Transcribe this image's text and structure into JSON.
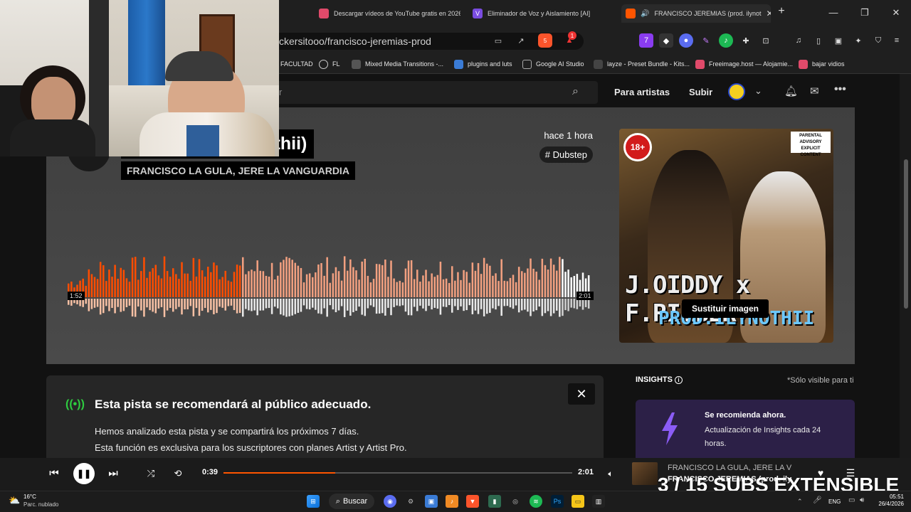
{
  "browser": {
    "tabs": [
      {
        "label": "Descargar vídeos de YouTube gratis en 2026",
        "color": "#e04a6a"
      },
      {
        "label": "Eliminador de Voz y Aislamiento [AI]",
        "color": "#7a4ce0"
      },
      {
        "label": "FRANCISCO JEREMIAS (prod. ilynot",
        "color": "#ff5500"
      }
    ],
    "url": "ckersitooo/francisco-jeremias-prod",
    "bookmarks": [
      {
        "label": "FACULTAD"
      },
      {
        "label": "FL"
      },
      {
        "label": "Mixed Media Transitions -..."
      },
      {
        "label": "plugins and luts"
      },
      {
        "label": "Google AI Studio"
      },
      {
        "label": "layze - Preset Bundle - Kits..."
      },
      {
        "label": "Freeimage.host — Alojamie..."
      },
      {
        "label": "bajar vidios"
      }
    ],
    "brave_badge": "5",
    "alert_badge": "1"
  },
  "nav": {
    "search_placeholder": "r",
    "for_artists": "Para artistas",
    "upload": "Subir"
  },
  "track": {
    "title": "MIAS (prod. ilynothii)",
    "artists": "FRANCISCO LA GULA, JERE LA VANGUARDIA",
    "posted": "hace 1 hora",
    "genre": "# Dubstep",
    "elapsed_badge": "1:52",
    "duration_badge": "2:01",
    "played_fraction": 0.33,
    "buffered_fraction": 0.94,
    "artwork": {
      "age_badge": "18+",
      "advisory": "PARENTAL ADVISORY EXPLICIT CONTENT",
      "title": "J.OIDDY x F.RIEBER",
      "prod": "PROD.ILYNOTHII",
      "replace_button": "Sustituir imagen"
    }
  },
  "recommendation": {
    "title": "Esta pista se recomendará al público adecuado.",
    "line1": "Hemos analizado esta pista y se compartirá los próximos 7 días.",
    "line2": "Esta función es exclusiva para los suscriptores con planes Artist y Artist Pro."
  },
  "insights": {
    "heading": "INSIGHTS",
    "note": "*Sólo visible para ti",
    "card_title": "Se recomienda ahora.",
    "card_text": "Actualización de Insights cada 24 horas."
  },
  "player": {
    "current": "0:39",
    "duration": "2:01",
    "progress_fraction": 0.32,
    "now_playing_artist": "FRANCISCO LA GULA, JERE LA V",
    "now_playing_title": "FRANCISCO JEREMIAS (prod. ilyn"
  },
  "overlay_text": "3 / 15 SUBS EXTENSIBLE",
  "taskbar": {
    "weather_temp": "16°C",
    "weather_desc": "Parc. nublado",
    "search": "Buscar",
    "lang": "ENG",
    "time": "05:51",
    "date": "26/4/2026"
  },
  "colors": {
    "accent": "#ff5500",
    "played": "#ff4d00",
    "unplayed": "#f2a080",
    "insights_bg": "#2c2047"
  }
}
